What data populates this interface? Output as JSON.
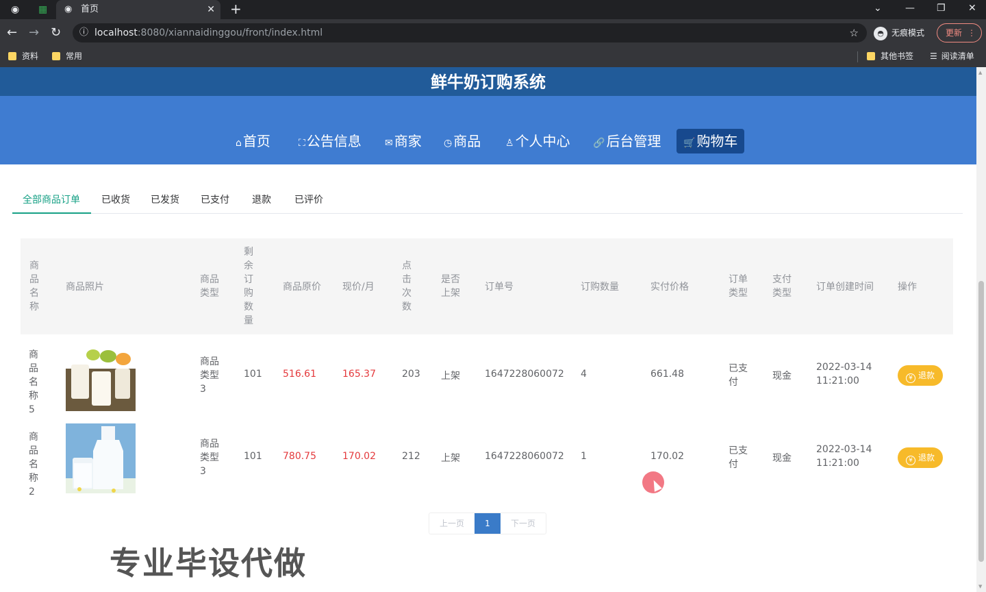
{
  "browser": {
    "tab_title": "首页",
    "tab_close": "✕",
    "new_tab": "+",
    "url_host": "localhost",
    "url_path": ":8080/xiannaidinggou/front/index.html",
    "incognito_label": "无痕模式",
    "update_label": "更新",
    "bookmarks": [
      "资料",
      "常用"
    ],
    "other_bookmarks": "其他书签",
    "reading_list": "阅读清单"
  },
  "site": {
    "title": "鲜牛奶订购系统",
    "nav": [
      {
        "label": "首页",
        "icon": "⌂"
      },
      {
        "label": "公告信息",
        "icon": "⛶"
      },
      {
        "label": "商家",
        "icon": "✉"
      },
      {
        "label": "商品",
        "icon": "◷"
      },
      {
        "label": "个人中心",
        "icon": "♙"
      },
      {
        "label": "后台管理",
        "icon": "🔗"
      },
      {
        "label": "购物车",
        "icon": "🛒"
      }
    ]
  },
  "order_tabs": [
    "全部商品订单",
    "已收货",
    "已发货",
    "已支付",
    "退款",
    "已评价"
  ],
  "table": {
    "headers": {
      "name": "商品名称",
      "photo": "商品照片",
      "type": "商品类型",
      "remaining": "剩余订购数量",
      "orig_price": "商品原价",
      "price": "现价/月",
      "clicks": "点击次数",
      "on_shelf": "是否上架",
      "order_no": "订单号",
      "qty": "订购数量",
      "paid": "实付价格",
      "order_type": "订单类型",
      "pay_type": "支付类型",
      "created": "订单创建时间",
      "action": "操作"
    },
    "rows": [
      {
        "name": "商品名称5",
        "type": "商品类型3",
        "remaining": "101",
        "orig_price": "516.61",
        "price": "165.37",
        "clicks": "203",
        "on_shelf": "上架",
        "order_no": "1647228060072",
        "qty": "4",
        "paid": "661.48",
        "order_type": "已支付",
        "pay_type": "现金",
        "created_date": "2022-03-14",
        "created_time": "11:21:00",
        "action": "退款"
      },
      {
        "name": "商品名称2",
        "type": "商品类型3",
        "remaining": "101",
        "orig_price": "780.75",
        "price": "170.02",
        "clicks": "212",
        "on_shelf": "上架",
        "order_no": "1647228060072",
        "qty": "1",
        "paid": "170.02",
        "order_type": "已支付",
        "pay_type": "现金",
        "created_date": "2022-03-14",
        "created_time": "11:21:00",
        "action": "退款"
      }
    ]
  },
  "pager": {
    "prev": "上一页",
    "current": "1",
    "next": "下一页"
  },
  "watermark": "专业毕设代做",
  "colors": {
    "header_dark": "#215b99",
    "nav_blue": "#3f7cd1",
    "accent_green": "#16a085",
    "price_red": "#e4393c",
    "button_yellow": "#f7ba2a"
  }
}
